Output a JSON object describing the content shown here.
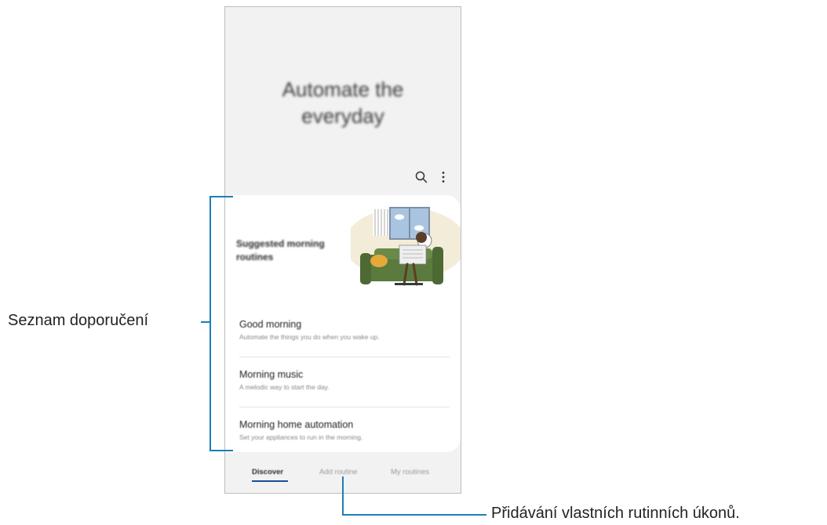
{
  "hero": {
    "line1": "Automate the",
    "line2": "everyday"
  },
  "toolbar": {
    "search_icon": "search-icon",
    "more_icon": "more-vert-icon"
  },
  "card": {
    "heading": "Suggested morning routines",
    "items": [
      {
        "title": "Good morning",
        "description": "Automate the things you do when you wake up."
      },
      {
        "title": "Morning music",
        "description": "A melodic way to start the day."
      },
      {
        "title": "Morning home automation",
        "description": "Set your appliances to run in the morning."
      }
    ]
  },
  "tabs": [
    {
      "label": "Discover",
      "active": true
    },
    {
      "label": "Add routine",
      "active": false
    },
    {
      "label": "My routines",
      "active": false
    }
  ],
  "annotations": {
    "recommendations": "Seznam doporučení",
    "add_routine": "Přidávání vlastních rutinních úkonů."
  },
  "colors": {
    "callout_line": "#1b7fb8",
    "tab_underline": "#1a4f9c",
    "sofa": "#5a7a3e"
  }
}
